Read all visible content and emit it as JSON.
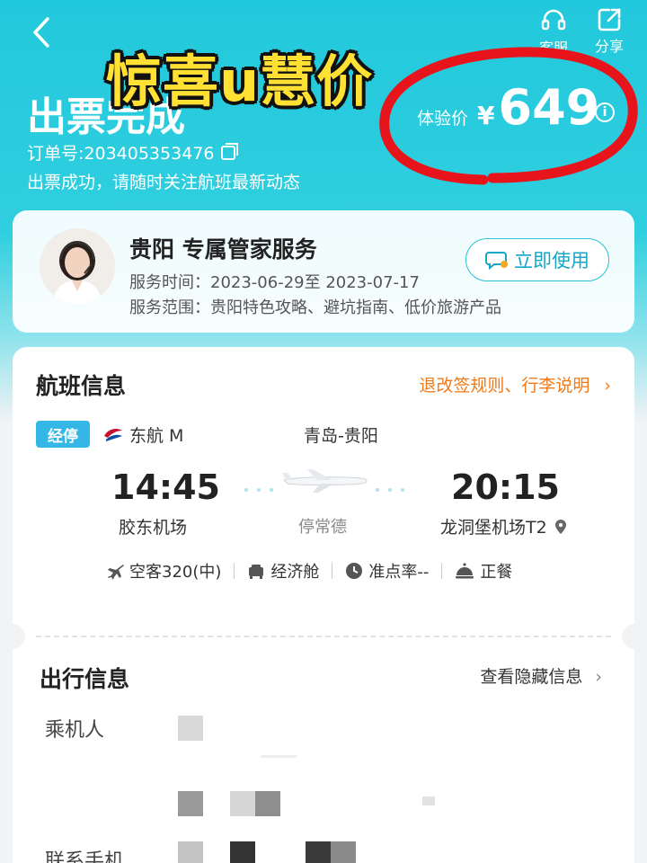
{
  "header": {
    "back_icon": "chevron-left-icon",
    "service_label": "客服",
    "share_label": "分享",
    "promo_text": "惊喜u慧价",
    "title": "出票完成",
    "order_label": "订单号:",
    "order_number": "203405353476",
    "status_text": "出票成功，请随时关注航班最新动态",
    "price_label": "体验价",
    "price_currency": "¥",
    "price_value": "649",
    "info_glyph": "i",
    "accent_color": "#22c8dc",
    "annotation_color": "#e8141b"
  },
  "service_card": {
    "title": "贵阳 专属管家服务",
    "time_label": "服务时间：",
    "time_value": "2023-06-29至 2023-07-17",
    "scope_label": "服务范围：",
    "scope_value": "贵阳特色攻略、避坑指南、低价旅游产品",
    "button_label": "立即使用"
  },
  "flight": {
    "section_title": "航班信息",
    "rules_link": "退改签规则、行李说明",
    "rules_arrow": "›",
    "stop_tag": "经停",
    "airline": "东航 M",
    "route": "青岛-贵阳",
    "depart_time": "14:45",
    "depart_airport": "胶东机场",
    "stop_city": "停常德",
    "arrive_time": "20:15",
    "arrive_airport": "龙洞堡机场T2",
    "aircraft": "空客320(中)",
    "cabin": "经济舱",
    "on_time": "准点率--",
    "meal": "正餐"
  },
  "travel": {
    "section_title": "出行信息",
    "hidden_link": "查看隐藏信息",
    "hidden_arrow": "›",
    "passenger_label": "乘机人",
    "phone_label": "联系手机"
  }
}
